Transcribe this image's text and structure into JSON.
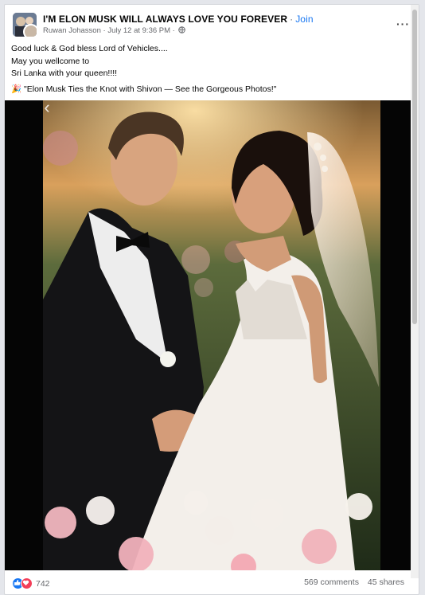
{
  "post": {
    "group_name": "I'M ELON MUSK WILL ALWAYS LOVE YOU FOREVER",
    "separator": "·",
    "join_label": "Join",
    "author": "Ruwan Johasson",
    "date": "July 12 at 9:36 PM",
    "meta_separator": "·",
    "more_label": "···",
    "text_lines": [
      "Good luck & God bless Lord of Vehicles....",
      "May you wellcome to",
      "Sri Lanka with your queen!!!!"
    ],
    "share_emoji": "🎉",
    "share_title": "\"Elon Musk Ties the Knot with Shivon — See the Gorgeous Photos!\"",
    "prev_arrow": "‹"
  },
  "footer": {
    "reaction_count": "742",
    "comments": "569 comments",
    "shares": "45 shares"
  },
  "colors": {
    "link": "#1877f2",
    "like": "#1877f2",
    "love": "#f33e58",
    "meta": "#65676b"
  },
  "icons": [
    "globe-icon",
    "more-options-icon",
    "like-reaction-icon",
    "love-reaction-icon",
    "prev-arrow-icon"
  ]
}
